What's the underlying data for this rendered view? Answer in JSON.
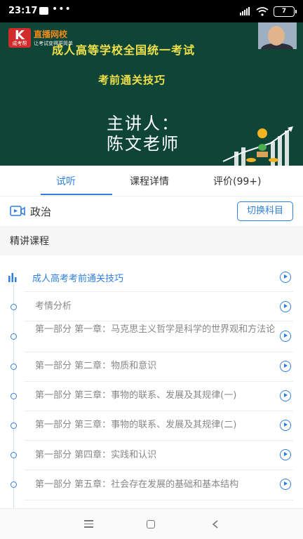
{
  "status_bar": {
    "time": "23:17",
    "dots": "•••",
    "battery": "7"
  },
  "video": {
    "brand_icon": "K",
    "brand_sub": "成考帮",
    "brand_name": "直播网校",
    "brand_slogan": "让考试变得更简单",
    "title": "成人高等学校全国统一考试",
    "subtitle": "考前通关技巧",
    "lecturer_line1": "主讲人：",
    "lecturer_line2": "陈文老师"
  },
  "tabs": [
    {
      "label": "试听",
      "active": true
    },
    {
      "label": "课程详情",
      "active": false
    },
    {
      "label": "评价(99+)",
      "active": false
    }
  ],
  "subject": {
    "name": "政治",
    "switch_label": "切换科目",
    "icon": "video-icon"
  },
  "section_title": "精讲课程",
  "chapter": {
    "title": "成人高考考前通关技巧",
    "icon": "bar-chart-icon"
  },
  "lessons": [
    "考情分析",
    "第一部分 第一章：马克思主义哲学是科学的世界观和方法论",
    "第一部分 第二章：物质和意识",
    "第一部分 第三章：事物的联系、发展及其规律(一)",
    "第一部分 第三章：事物的联系、发展及其规律(二)",
    "第一部分 第四章：实践和认识",
    "第一部分 第五章：社会存在发展的基础和基本结构"
  ],
  "colors": {
    "accent": "#2f7fe0",
    "video_bg": "#0e4537",
    "title_yellow": "#f0e14a"
  }
}
